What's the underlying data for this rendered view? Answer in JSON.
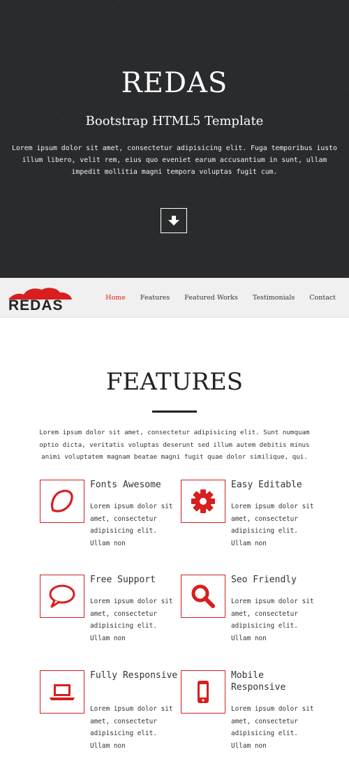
{
  "hero": {
    "title": "REDAS",
    "subtitle": "Bootstrap HTML5 Template",
    "text": "Lorem ipsum dolor sit amet, consectetur adipisicing elit. Fuga temporibus iusto illum libero, velit rem, eius quo eveniet earum accusantium in sunt, ullam impedit mollitia magni tempora voluptas fugit cum.",
    "button_icon": "arrow-down-icon"
  },
  "navbar": {
    "logo_text": "REDAS",
    "items": [
      {
        "label": "Home",
        "active": true
      },
      {
        "label": "Features"
      },
      {
        "label": "Featured Works"
      },
      {
        "label": "Testimonials"
      },
      {
        "label": "Contact"
      }
    ]
  },
  "features": {
    "title": "FEATURES",
    "intro": "Lorem ipsum dolor sit amet, consectetur adipisicing elit. Sunt numquam optio dicta, veritatis voluptas deserunt sed illum autem debitis minus animi voluptatem magnam beatae magni fugit quae dolor similique, qui.",
    "items": [
      {
        "title": "Fonts Awesome",
        "icon": "lemon-icon",
        "desc": "Lorem ipsum dolor sit amet, consectetur adipisicing elit. Ullam non"
      },
      {
        "title": "Easy Editable",
        "icon": "gear-icon",
        "desc": "Lorem ipsum dolor sit amet, consectetur adipisicing elit. Ullam non"
      },
      {
        "title": "Free Support",
        "icon": "comment-icon",
        "desc": "Lorem ipsum dolor sit amet, consectetur adipisicing elit. Ullam non"
      },
      {
        "title": "Seo Friendly",
        "icon": "search-icon",
        "desc": "Lorem ipsum dolor sit amet, consectetur adipisicing elit. Ullam non"
      },
      {
        "title": "Fully Responsive",
        "icon": "laptop-icon",
        "desc": "Lorem ipsum dolor sit amet, consectetur adipisicing elit. Ullam non"
      },
      {
        "title": "Mobile Responsive",
        "icon": "mobile-icon",
        "desc": "Lorem ipsum dolor sit amet, consectetur adipisicing elit. Ullam non"
      }
    ]
  },
  "colors": {
    "accent": "#d81e1e",
    "hero_bg": "#2a2b2c",
    "navbar_bg": "#f0f0f0"
  }
}
